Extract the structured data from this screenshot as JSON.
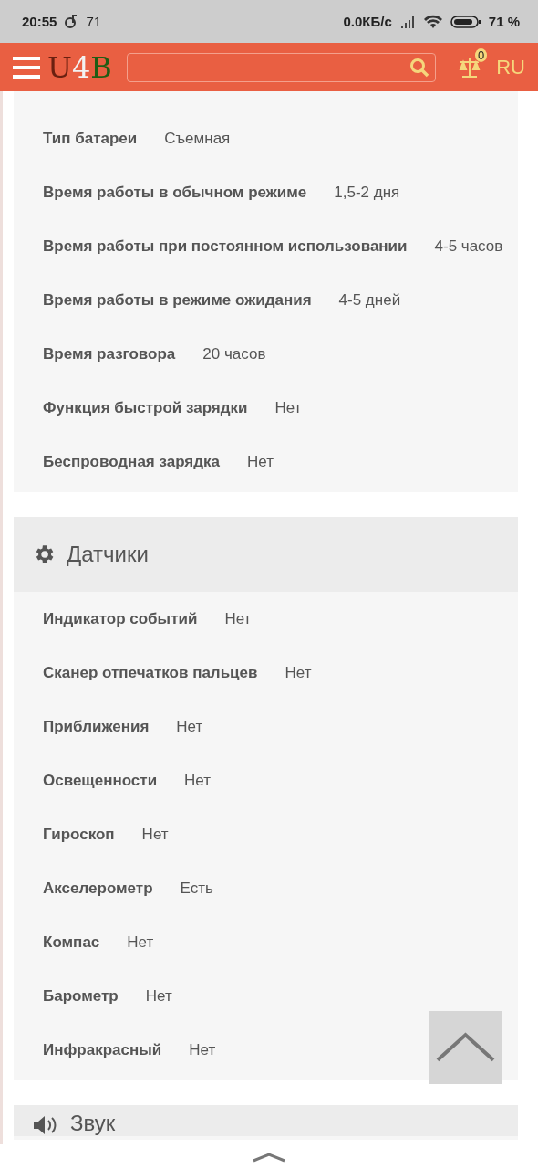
{
  "status_bar": {
    "time": "20:55",
    "notification_count": "71",
    "network_speed": "0.0КБ/с",
    "battery": "71 %"
  },
  "header": {
    "logo": [
      "U",
      "4",
      "B"
    ],
    "compare_count": "0",
    "language": "RU"
  },
  "sections": [
    {
      "kind": "plain",
      "rows": [
        {
          "label": "Тип батареи",
          "value": "Съемная"
        },
        {
          "label": "Время работы в обычном режиме",
          "value": "1,5-2 дня"
        },
        {
          "label": "Время работы при постоянном использовании",
          "value": "4-5 часов"
        },
        {
          "label": "Время работы в режиме ожидания",
          "value": "4-5 дней"
        },
        {
          "label": "Время разговора",
          "value": "20 часов"
        },
        {
          "label": "Функция быстрой зарядки",
          "value": "Нет"
        },
        {
          "label": "Беспроводная зарядка",
          "value": "Нет"
        }
      ]
    },
    {
      "kind": "sensors",
      "title": "Датчики",
      "rows": [
        {
          "label": "Индикатор событий",
          "value": "Нет"
        },
        {
          "label": "Сканер отпечатков пальцев",
          "value": "Нет"
        },
        {
          "label": "Приближения",
          "value": "Нет"
        },
        {
          "label": "Освещенности",
          "value": "Нет"
        },
        {
          "label": "Гироскоп",
          "value": "Нет"
        },
        {
          "label": "Акселерометр",
          "value": "Есть"
        },
        {
          "label": "Компас",
          "value": "Нет"
        },
        {
          "label": "Барометр",
          "value": "Нет"
        },
        {
          "label": "Инфракрасный",
          "value": "Нет"
        }
      ]
    },
    {
      "kind": "sound",
      "title": "Звук"
    }
  ]
}
